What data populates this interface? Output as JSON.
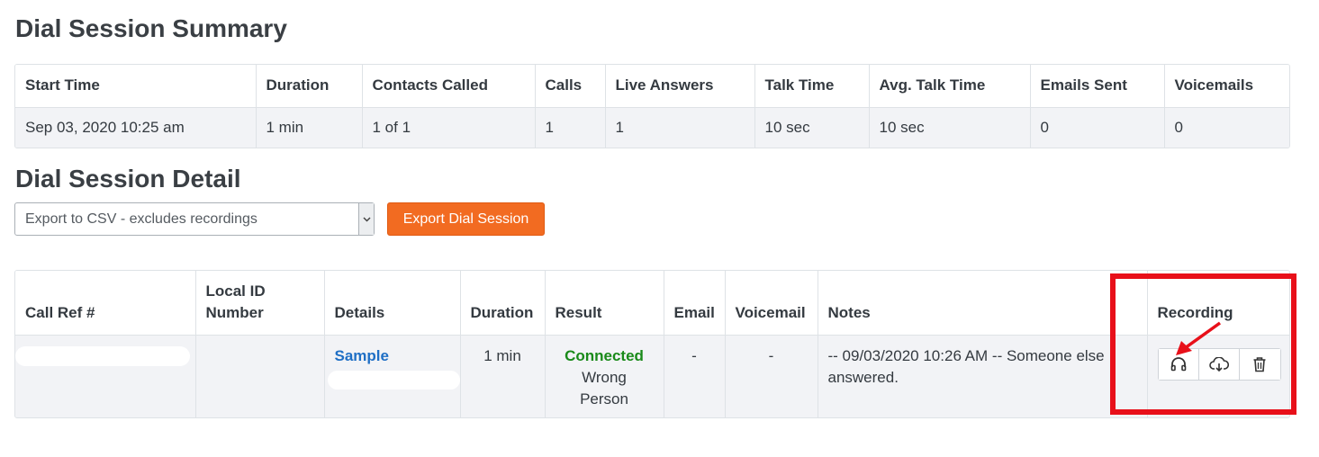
{
  "summary": {
    "title": "Dial Session Summary",
    "headers": [
      "Start Time",
      "Duration",
      "Contacts Called",
      "Calls",
      "Live Answers",
      "Talk Time",
      "Avg. Talk Time",
      "Emails Sent",
      "Voicemails"
    ],
    "row": [
      "Sep 03, 2020 10:25 am",
      "1 min",
      "1 of 1",
      "1",
      "1",
      "10 sec",
      "10 sec",
      "0",
      "0"
    ]
  },
  "detail": {
    "title": "Dial Session Detail",
    "export_select": {
      "selected": "Export to CSV - excludes recordings"
    },
    "export_button": "Export Dial Session",
    "headers": {
      "call_ref": "Call Ref #",
      "local_id_line1": "Local ID",
      "local_id_line2": "Number",
      "details": "Details",
      "duration": "Duration",
      "result": "Result",
      "email": "Email",
      "voicemail": "Voicemail",
      "notes": "Notes",
      "recording": "Recording"
    },
    "row": {
      "details_link": "Sample",
      "duration": "1 min",
      "result_status": "Connected",
      "result_line1": "Wrong",
      "result_line2": "Person",
      "email": "-",
      "voicemail": "-",
      "notes": "-- 09/03/2020 10:26 AM -- Someone else answered."
    },
    "recording_actions": [
      "headphones-icon",
      "cloud-download-icon",
      "trash-icon"
    ]
  },
  "colors": {
    "accent_orange": "#f26b21",
    "link_blue": "#1f6fc5",
    "connected_green": "#1a8a1a",
    "annotation_red": "#e8101a"
  }
}
